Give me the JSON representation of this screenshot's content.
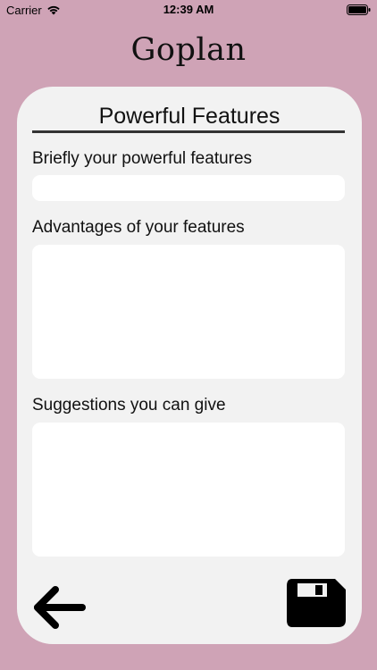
{
  "status_bar": {
    "carrier": "Carrier",
    "time": "12:39 AM"
  },
  "app": {
    "title": "Goplan"
  },
  "form": {
    "title": "Powerful Features",
    "fields": [
      {
        "label": "Briefly your powerful features",
        "value": ""
      },
      {
        "label": "Advantages of your features",
        "value": ""
      },
      {
        "label": "Suggestions you can give",
        "value": ""
      }
    ]
  },
  "icons": {
    "back": "left-arrow-icon",
    "save": "floppy-disk-icon"
  },
  "colors": {
    "background": "#cfa3b6",
    "card": "#f2f2f2",
    "input": "#ffffff",
    "text": "#111111"
  }
}
